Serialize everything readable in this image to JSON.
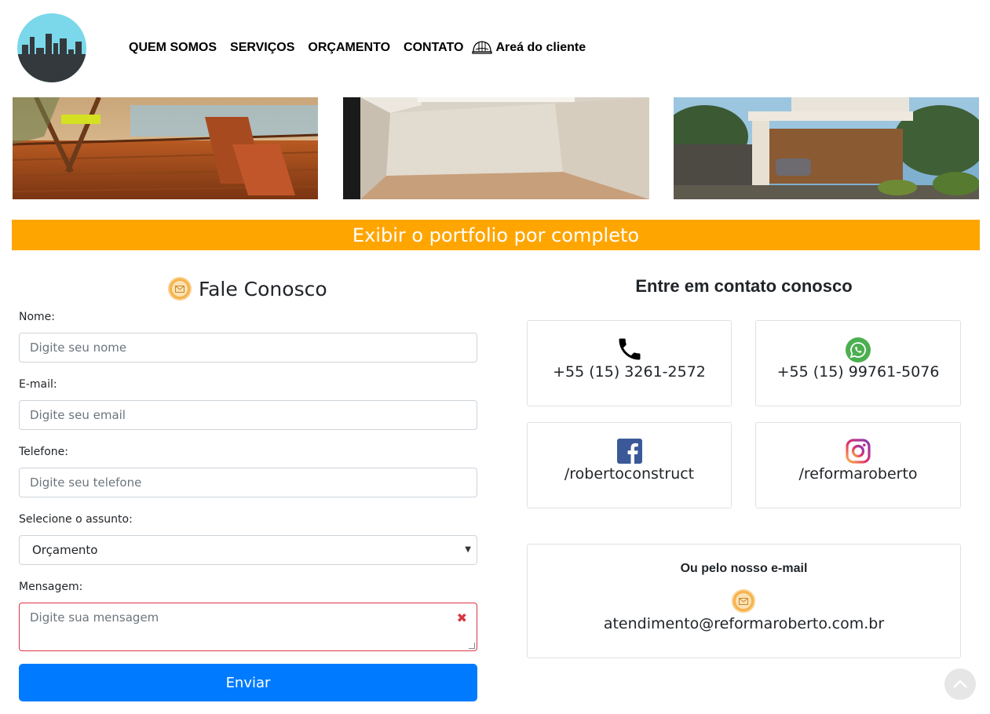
{
  "nav": {
    "items": [
      "QUEM SOMOS",
      "SERVIÇOS",
      "ORÇAMENTO",
      "CONTATO"
    ],
    "client_area": "Areá do cliente"
  },
  "portfolio": {
    "button": "Exibir o portfolio por completo"
  },
  "form": {
    "title": "Fale Conosco",
    "name_label": "Nome:",
    "name_placeholder": "Digite seu nome",
    "email_label": "E-mail:",
    "email_placeholder": "Digite seu email",
    "phone_label": "Telefone:",
    "phone_placeholder": "Digite seu telefone",
    "subject_label": "Selecione o assunto:",
    "subject_value": "Orçamento",
    "message_label": "Mensagem:",
    "message_placeholder": "Digite sua mensagem",
    "submit": "Enviar"
  },
  "contact": {
    "title": "Entre em contato conosco",
    "phone": "+55 (15) 3261-2572",
    "whatsapp": "+55 (15) 99761-5076",
    "facebook": "/robertoconstruct",
    "instagram": "/reformaroberto",
    "email_title": "Ou pelo nosso e-mail",
    "email": "atendimento@reformaroberto.com.br"
  },
  "colors": {
    "accent": "#ffa500",
    "primary_button": "#007bff",
    "error": "#dc3545",
    "whatsapp": "#4caf50",
    "facebook": "#3b5998"
  }
}
